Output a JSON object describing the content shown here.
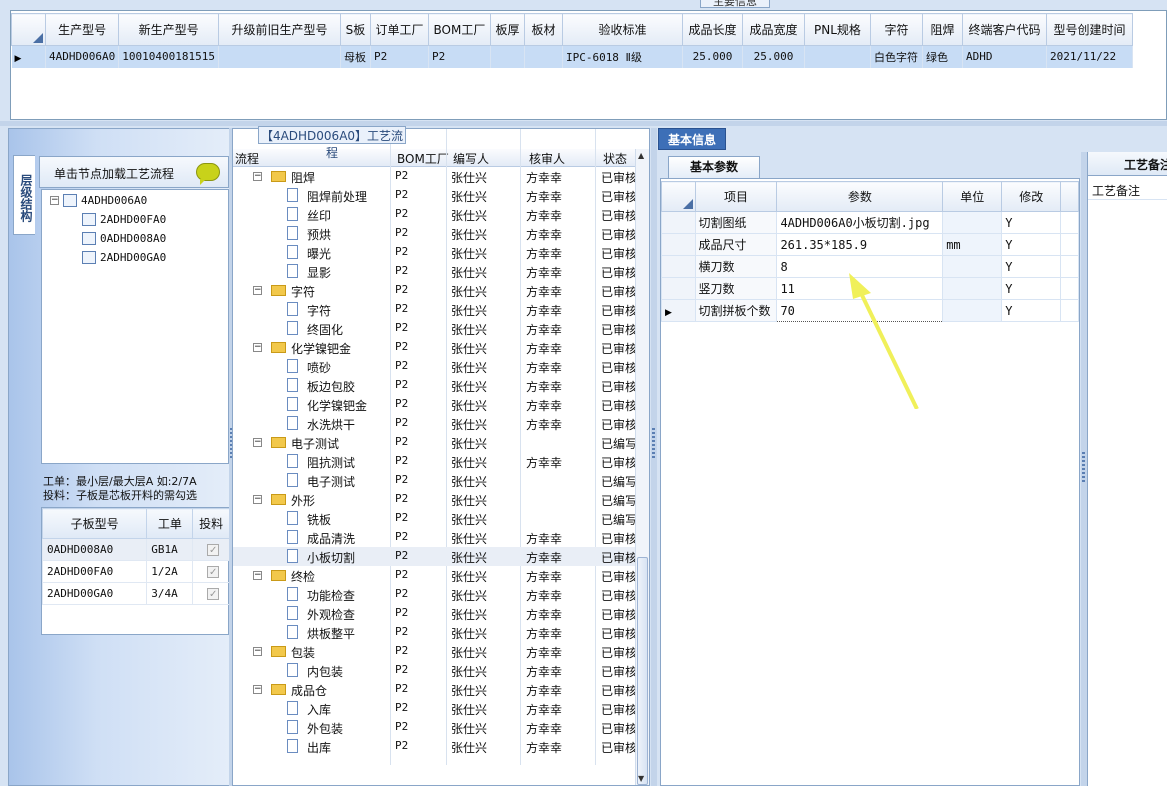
{
  "top": {
    "section_title": "主要信息",
    "columns": [
      "生产型号",
      "新生产型号",
      "升级前旧生产型号",
      "S板",
      "订单工厂",
      "BOM工厂",
      "板厚",
      "板材",
      "验收标准",
      "成品长度",
      "成品宽度",
      "PNL规格",
      "字符",
      "阻焊",
      "终端客户代码",
      "型号创建时间"
    ],
    "row": {
      "生产型号": "4ADHD006A0",
      "新生产型号": "10010400181515",
      "升级前旧生产型号": "",
      "S板": "母板",
      "订单工厂": "P2",
      "BOM工厂": "P2",
      "板厚": "",
      "板材": "",
      "验收标准": "IPC-6018 Ⅱ级",
      "成品长度": "25.000",
      "成品宽度": "25.000",
      "PNL规格": "",
      "字符": "白色字符",
      "阻焊": "绿色",
      "终端客户代码": "ADHD",
      "型号创建时间": "2021/11/22"
    }
  },
  "left": {
    "vertical_tab": "层级结构",
    "tree_header": "单击节点加载工艺流程",
    "tree": [
      "4ADHD006A0",
      "2ADHD00FA0",
      "0ADHD008A0",
      "2ADHD00GA0"
    ],
    "legend_line1": "工单：最小层/最大层A 如:2/7A",
    "legend_line2": "投料：子板是芯板开料的需勾选",
    "sub_columns": [
      "子板型号",
      "工单",
      "投料"
    ],
    "sub_rows": [
      {
        "model": "0ADHD008A0",
        "order": "GB1A",
        "feed": true
      },
      {
        "model": "2ADHD00FA0",
        "order": "1/2A",
        "feed": true
      },
      {
        "model": "2ADHD00GA0",
        "order": "3/4A",
        "feed": true
      }
    ]
  },
  "process": {
    "title": "【4ADHD006A0】工艺流程",
    "columns": [
      "流程",
      "BOM工厂",
      "编写人",
      "核审人",
      "状态"
    ],
    "rows": [
      {
        "level": 0,
        "name": "阻焊",
        "bom": "P2",
        "writer": "张仕兴",
        "checker": "方幸幸",
        "status": "已审核"
      },
      {
        "level": 1,
        "name": "阻焊前处理",
        "bom": "P2",
        "writer": "张仕兴",
        "checker": "方幸幸",
        "status": "已审核"
      },
      {
        "level": 1,
        "name": "丝印",
        "bom": "P2",
        "writer": "张仕兴",
        "checker": "方幸幸",
        "status": "已审核"
      },
      {
        "level": 1,
        "name": "预烘",
        "bom": "P2",
        "writer": "张仕兴",
        "checker": "方幸幸",
        "status": "已审核"
      },
      {
        "level": 1,
        "name": "曝光",
        "bom": "P2",
        "writer": "张仕兴",
        "checker": "方幸幸",
        "status": "已审核"
      },
      {
        "level": 1,
        "name": "显影",
        "bom": "P2",
        "writer": "张仕兴",
        "checker": "方幸幸",
        "status": "已审核"
      },
      {
        "level": 0,
        "name": "字符",
        "bom": "P2",
        "writer": "张仕兴",
        "checker": "方幸幸",
        "status": "已审核"
      },
      {
        "level": 1,
        "name": "字符",
        "bom": "P2",
        "writer": "张仕兴",
        "checker": "方幸幸",
        "status": "已审核"
      },
      {
        "level": 1,
        "name": "终固化",
        "bom": "P2",
        "writer": "张仕兴",
        "checker": "方幸幸",
        "status": "已审核"
      },
      {
        "level": 0,
        "name": "化学镍钯金",
        "bom": "P2",
        "writer": "张仕兴",
        "checker": "方幸幸",
        "status": "已审核"
      },
      {
        "level": 1,
        "name": "喷砂",
        "bom": "P2",
        "writer": "张仕兴",
        "checker": "方幸幸",
        "status": "已审核"
      },
      {
        "level": 1,
        "name": "板边包胶",
        "bom": "P2",
        "writer": "张仕兴",
        "checker": "方幸幸",
        "status": "已审核"
      },
      {
        "level": 1,
        "name": "化学镍钯金",
        "bom": "P2",
        "writer": "张仕兴",
        "checker": "方幸幸",
        "status": "已审核"
      },
      {
        "level": 1,
        "name": "水洗烘干",
        "bom": "P2",
        "writer": "张仕兴",
        "checker": "方幸幸",
        "status": "已审核"
      },
      {
        "level": 0,
        "name": "电子测试",
        "bom": "P2",
        "writer": "张仕兴",
        "checker": "",
        "status": "已编写"
      },
      {
        "level": 1,
        "name": "阻抗测试",
        "bom": "P2",
        "writer": "张仕兴",
        "checker": "方幸幸",
        "status": "已审核"
      },
      {
        "level": 1,
        "name": "电子测试",
        "bom": "P2",
        "writer": "张仕兴",
        "checker": "",
        "status": "已编写"
      },
      {
        "level": 0,
        "name": "外形",
        "bom": "P2",
        "writer": "张仕兴",
        "checker": "",
        "status": "已编写"
      },
      {
        "level": 1,
        "name": "铣板",
        "bom": "P2",
        "writer": "张仕兴",
        "checker": "",
        "status": "已编写"
      },
      {
        "level": 1,
        "name": "成品清洗",
        "bom": "P2",
        "writer": "张仕兴",
        "checker": "方幸幸",
        "status": "已审核"
      },
      {
        "level": 1,
        "name": "小板切割",
        "bom": "P2",
        "writer": "张仕兴",
        "checker": "方幸幸",
        "status": "已审核",
        "selected": true
      },
      {
        "level": 0,
        "name": "终检",
        "bom": "P2",
        "writer": "张仕兴",
        "checker": "方幸幸",
        "status": "已审核"
      },
      {
        "level": 1,
        "name": "功能检查",
        "bom": "P2",
        "writer": "张仕兴",
        "checker": "方幸幸",
        "status": "已审核"
      },
      {
        "level": 1,
        "name": "外观检查",
        "bom": "P2",
        "writer": "张仕兴",
        "checker": "方幸幸",
        "status": "已审核"
      },
      {
        "level": 1,
        "name": "烘板整平",
        "bom": "P2",
        "writer": "张仕兴",
        "checker": "方幸幸",
        "status": "已审核"
      },
      {
        "level": 0,
        "name": "包装",
        "bom": "P2",
        "writer": "张仕兴",
        "checker": "方幸幸",
        "status": "已审核"
      },
      {
        "level": 1,
        "name": "内包装",
        "bom": "P2",
        "writer": "张仕兴",
        "checker": "方幸幸",
        "status": "已审核"
      },
      {
        "level": 0,
        "name": "成品仓",
        "bom": "P2",
        "writer": "张仕兴",
        "checker": "方幸幸",
        "status": "已审核"
      },
      {
        "level": 1,
        "name": "入库",
        "bom": "P2",
        "writer": "张仕兴",
        "checker": "方幸幸",
        "status": "已审核"
      },
      {
        "level": 1,
        "name": "外包装",
        "bom": "P2",
        "writer": "张仕兴",
        "checker": "方幸幸",
        "status": "已审核"
      },
      {
        "level": 1,
        "name": "出库",
        "bom": "P2",
        "writer": "张仕兴",
        "checker": "方幸幸",
        "status": "已审核"
      }
    ]
  },
  "basic": {
    "tab": "基本信息",
    "subtab": "基本参数",
    "columns": [
      "项目",
      "参数",
      "单位",
      "修改"
    ],
    "rows": [
      {
        "item": "切割图纸",
        "param": "4ADHD006A0小板切割.jpg",
        "unit": "",
        "modify": "Y"
      },
      {
        "item": "成品尺寸",
        "param": "261.35*185.9",
        "unit": "mm",
        "modify": "Y"
      },
      {
        "item": "横刀数",
        "param": "8",
        "unit": "",
        "modify": "Y"
      },
      {
        "item": "竖刀数",
        "param": "11",
        "unit": "",
        "modify": "Y"
      },
      {
        "item": "切割拼板个数",
        "param": "70",
        "unit": "",
        "modify": "Y"
      }
    ],
    "side_title": "工艺备注",
    "side_column": "工艺备注",
    "accent": "#3d6fb7",
    "annotation_arrow_color": "#f0f05a"
  }
}
